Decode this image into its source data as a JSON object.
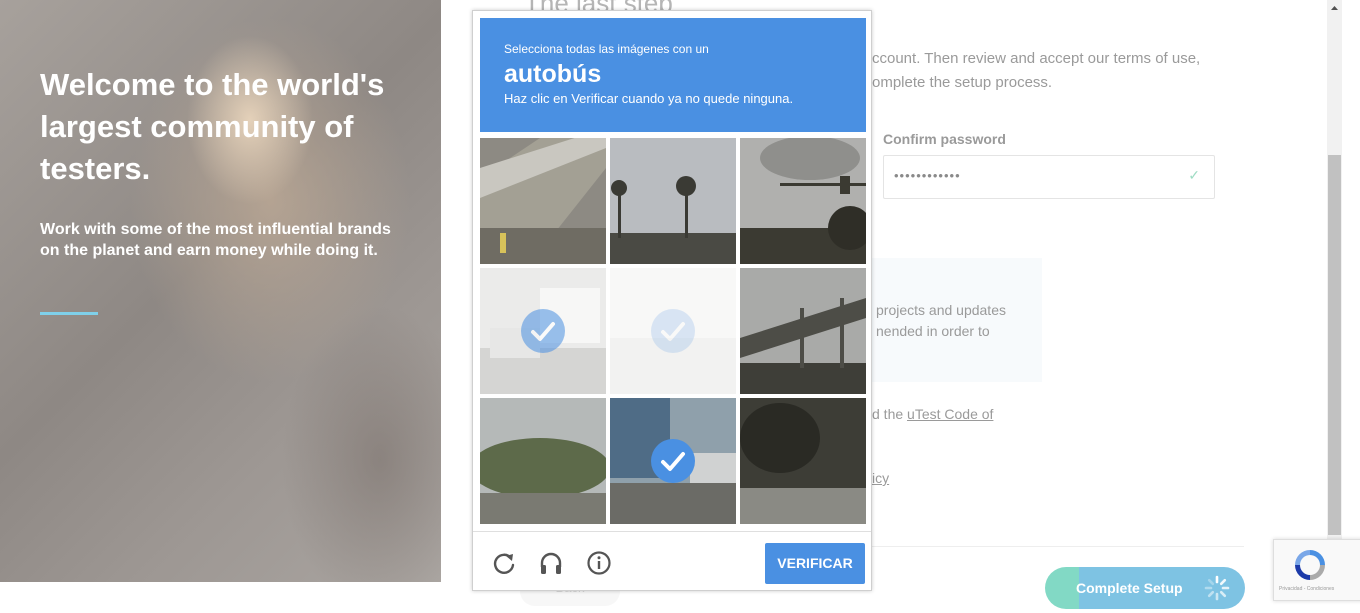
{
  "hero": {
    "title": "Welcome to the world's largest community of testers.",
    "subtitle": "Work with some of the most influential brands on the planet and earn money while doing it."
  },
  "form": {
    "title": "The last step",
    "intro": "ccount. Then review and accept our terms of use, omplete the setup process.",
    "confirm_password_label": "Confirm password",
    "confirm_password_value": "••••••••••••",
    "notice_text": "projects and updates nended in order to",
    "code_of_conduct_prefix": "d the ",
    "code_of_conduct_link": "uTest Code of",
    "policy_link": "icy",
    "back_label": "Back",
    "complete_label": "Complete Setup"
  },
  "captcha": {
    "instruction": "Selecciona todas las imágenes con un",
    "target": "autobús",
    "hint": "Haz clic en Verificar cuando ya no quede ninguna.",
    "verify_label": "VERIFICAR",
    "tiles": [
      {
        "label": "road-barrier",
        "selected": false,
        "state": "normal"
      },
      {
        "label": "palm-trees",
        "selected": false,
        "state": "normal"
      },
      {
        "label": "traffic-light",
        "selected": false,
        "state": "normal"
      },
      {
        "label": "bus-on-road",
        "selected": true,
        "state": "selected"
      },
      {
        "label": "faded-tile",
        "selected": true,
        "state": "loading"
      },
      {
        "label": "overpass",
        "selected": false,
        "state": "normal"
      },
      {
        "label": "trees-street",
        "selected": false,
        "state": "normal"
      },
      {
        "label": "bus-building",
        "selected": true,
        "state": "new-selected"
      },
      {
        "label": "dark-trees",
        "selected": false,
        "state": "normal"
      }
    ]
  },
  "recaptcha_badge": {
    "text": "Privacidad - Condiciones"
  },
  "colors": {
    "captcha_blue": "#4a90e2",
    "hero_rule": "#7fd0ea",
    "complete_green": "#82d9c5"
  }
}
